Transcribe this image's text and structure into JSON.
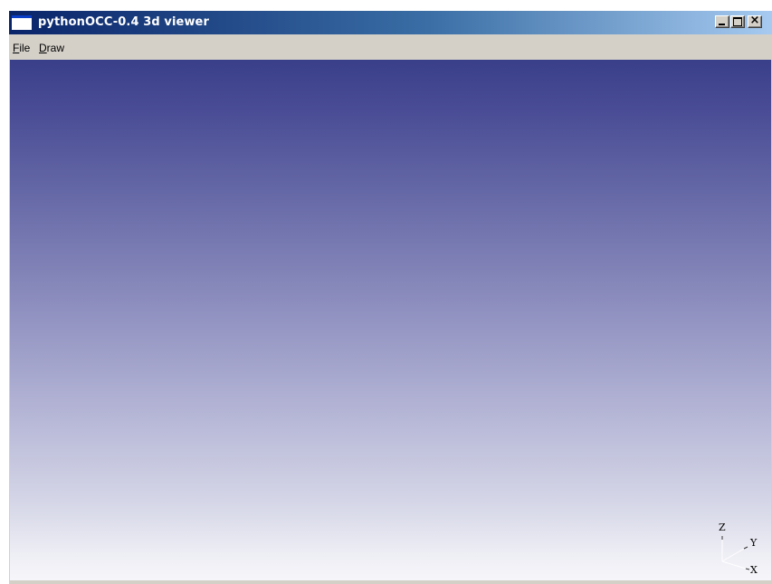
{
  "window": {
    "title": "pythonOCC-0.4 3d viewer",
    "controls": {
      "minimize": "minimize",
      "maximize": "maximize",
      "close": "×"
    }
  },
  "menubar": {
    "file": {
      "mnemonic": "F",
      "rest": "ile"
    },
    "draw": {
      "mnemonic": "D",
      "rest": "raw"
    }
  },
  "viewport": {
    "background_top": "#3a3f8a",
    "background_bottom": "#f6f6fa",
    "triedron": {
      "z_label": "Z",
      "y_label": "Y",
      "x_label": "X"
    }
  },
  "icons": {
    "app": "window-icon",
    "minimize": "minimize-icon",
    "maximize": "maximize-icon",
    "close": "close-icon"
  }
}
